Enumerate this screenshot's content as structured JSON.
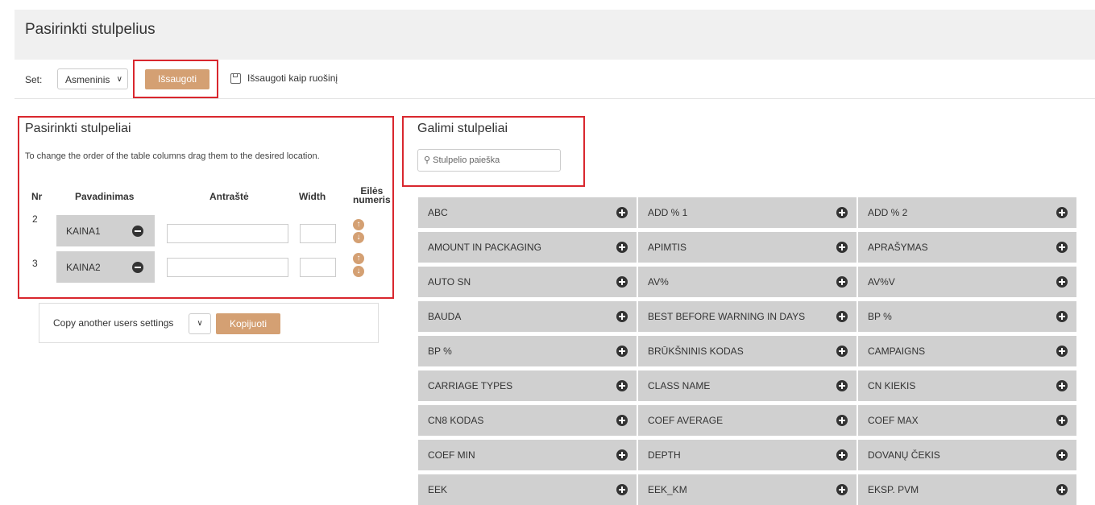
{
  "page": {
    "title": "Pasirinkti stulpelius"
  },
  "toolbar": {
    "set_label": "Set:",
    "set_value": "Asmeninis",
    "save_label": "Išsaugoti",
    "save_as_label": "Išsaugoti kaip ruošinį"
  },
  "selected": {
    "title": "Pasirinkti stulpeliai",
    "hint": "To change the order of the table columns drag them to the desired location.",
    "headers": {
      "nr": "Nr",
      "name": "Pavadinimas",
      "header": "Antraštė",
      "width": "Width",
      "order_line1": "Eilės",
      "order_line2": "numeris"
    },
    "rows": [
      {
        "nr": "2",
        "name": "KAINA1"
      },
      {
        "nr": "3",
        "name": "KAINA2"
      }
    ]
  },
  "copy": {
    "label": "Copy another users settings",
    "button": "Kopijuoti"
  },
  "available": {
    "title": "Galimi stulpeliai",
    "search_placeholder": "Stulpelio paieška",
    "items": [
      "ABC",
      "ADD % 1",
      "ADD % 2",
      "AMOUNT IN PACKAGING",
      "APIMTIS",
      "APRAŠYMAS",
      "AUTO SN",
      "AV%",
      "AV%V",
      "BAUDA",
      "BEST BEFORE WARNING IN DAYS",
      "BP %",
      "BP %",
      "BRŪKŠNINIS KODAS",
      "CAMPAIGNS",
      "CARRIAGE TYPES",
      "CLASS NAME",
      "CN KIEKIS",
      "CN8 KODAS",
      "COEF AVERAGE",
      "COEF MAX",
      "COEF MIN",
      "DEPTH",
      "DOVANŲ ČEKIS",
      "EEK",
      "EEK_KM",
      "EKSP. PVM"
    ]
  },
  "colors": {
    "accent": "#d4a073",
    "highlight": "#d9272e",
    "chip": "#d0d0d0"
  },
  "icons": {
    "save_as": "floppy-disk-icon",
    "search": "search-icon",
    "add": "plus-circle-icon",
    "remove": "minus-circle-icon",
    "up": "arrow-up-circle-icon",
    "down": "arrow-down-circle-icon"
  }
}
